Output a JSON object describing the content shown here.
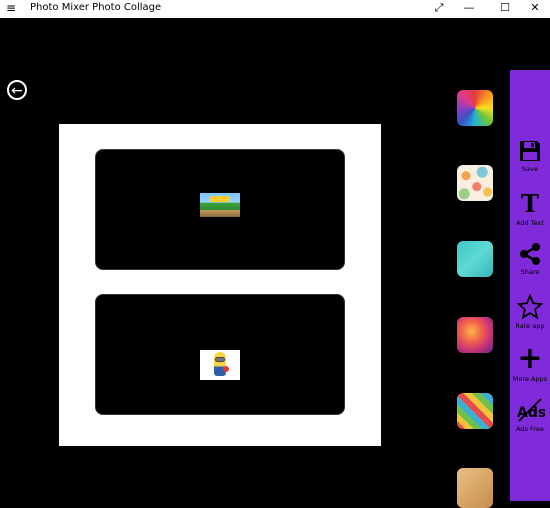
{
  "window": {
    "title": "Photo Mixer Photo Collage",
    "controls": {
      "menu": "≡",
      "expand": "⤢",
      "minimize": "—",
      "maximize": "☐",
      "close": "✕"
    }
  },
  "back_glyph": "←",
  "toolbar": {
    "save": "Save",
    "add_text": "Add Text",
    "share": "Share",
    "rate_app": "Rate app",
    "more_apps": "More Apps",
    "ads_free": "Ads Free",
    "text_glyph": "T",
    "plus_glyph": "+"
  },
  "backgrounds": [
    "color-wheel",
    "polka-dots",
    "turquoise-texture",
    "bokeh-gradient",
    "colorful-pattern",
    "wood-texture"
  ]
}
